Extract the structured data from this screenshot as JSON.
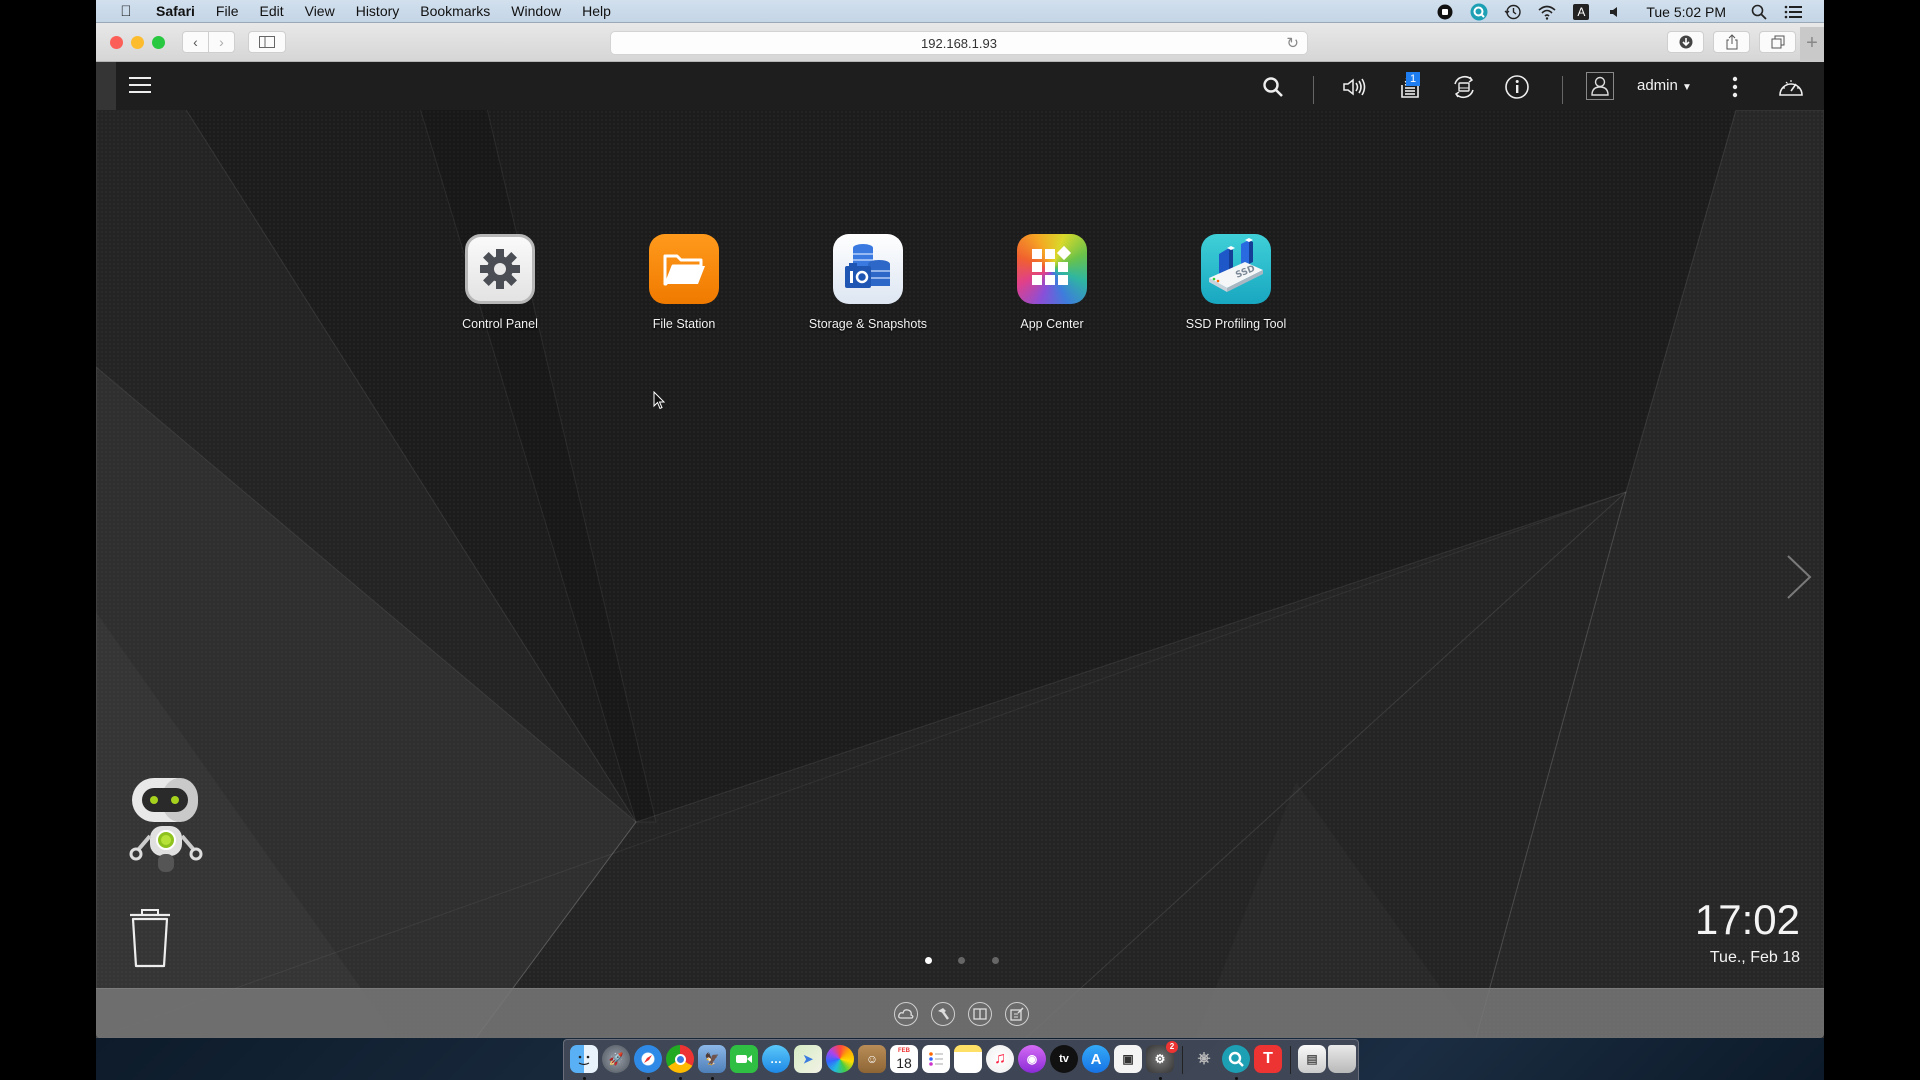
{
  "menubar": {
    "app_name": "Safari",
    "items": [
      "File",
      "Edit",
      "View",
      "History",
      "Bookmarks",
      "Window",
      "Help"
    ],
    "clock": "Tue 5:02 PM",
    "tray_icons": [
      "record-stop-icon",
      "qfinder-icon",
      "time-machine-icon",
      "wifi-icon",
      "input-source-icon",
      "volume-icon",
      "spotlight-icon",
      "notification-center-icon"
    ],
    "input_source_letter": "A"
  },
  "browser": {
    "url": "192.168.1.93",
    "new_tab_symbol": "+"
  },
  "nas": {
    "user": "admin",
    "notification_count": "1",
    "apps": [
      {
        "label": "Control Panel",
        "icon": "control-panel-icon"
      },
      {
        "label": "File Station",
        "icon": "file-station-icon"
      },
      {
        "label": "Storage & Snapshots",
        "icon": "storage-snapshots-icon"
      },
      {
        "label": "App Center",
        "icon": "app-center-icon"
      },
      {
        "label": "SSD Profiling Tool",
        "icon": "ssd-profiling-icon"
      }
    ],
    "ssd_text": "SSD",
    "clock_time": "17:02",
    "clock_date": "Tue., Feb 18",
    "pages": {
      "total": 3,
      "current": 1
    },
    "bottom_icons": [
      "myqnapcloud-icon",
      "utility-icon",
      "help-icon",
      "feedback-icon"
    ]
  },
  "dock": {
    "apps": [
      "Finder",
      "Launchpad",
      "Safari",
      "Chrome",
      "Preview",
      "FaceTime",
      "Messages",
      "Maps",
      "Photos",
      "Contacts",
      "Calendar",
      "Reminders",
      "Notes",
      "Music",
      "Podcasts",
      "TV",
      "App Store",
      "Screenshot",
      "System Preferences",
      "Utility",
      "Qfinder Pro",
      "Typora",
      "Document",
      "Trash"
    ],
    "calendar_day": "18",
    "calendar_month": "FEB",
    "tv_label": "tv",
    "sysprefs_badge": "2"
  }
}
